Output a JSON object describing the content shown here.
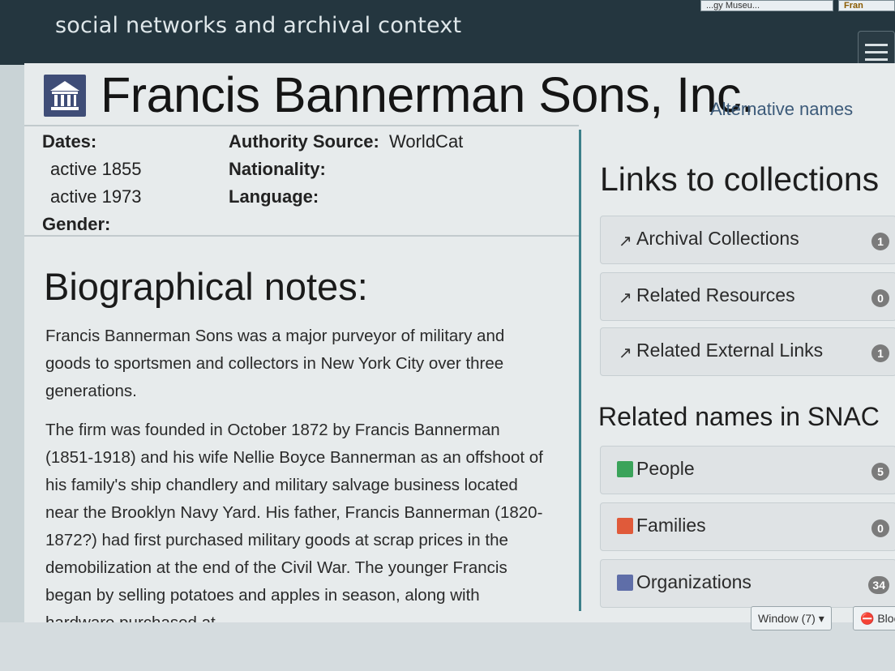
{
  "top": {
    "site_title": "social networks and archival context",
    "tab_a": "...gy Museu...",
    "tab_b": "Fran"
  },
  "entity": {
    "name": "Francis Bannerman Sons, Inc.",
    "alt_names_link": "Alternative names"
  },
  "meta": {
    "dates_label": "Dates:",
    "dates": [
      "active 1855",
      "active 1973"
    ],
    "gender_label": "Gender:",
    "authority_label": "Authority Source:",
    "authority_value": "WorldCat",
    "nationality_label": "Nationality:",
    "language_label": "Language:"
  },
  "bio": {
    "title": "Biographical notes:",
    "paragraphs": [
      "Francis Bannerman Sons was a major purveyor of military and goods to sportsmen and collectors in New York City over three generations.",
      "The firm was founded in October 1872 by Francis Bannerman (1851-1918) and his wife Nellie Boyce Bannerman as an offshoot of his family's ship chandlery and military salvage business located near the Brooklyn Navy Yard. His father, Francis Bannerman (1820-1872?) had first purchased military goods at scrap prices in the demobilization at the end of the Civil War. The younger Francis began by selling potatoes and apples in season, along with hardware purchased at"
    ]
  },
  "links": {
    "title": "Links to collections",
    "items": [
      {
        "label": "Archival Collections",
        "count": "1"
      },
      {
        "label": "Related Resources",
        "count": "0"
      },
      {
        "label": "Related External Links",
        "count": "1"
      }
    ]
  },
  "related": {
    "title": "Related names in SNAC",
    "items": [
      {
        "label": "People",
        "count": "5",
        "color": "#3aa35a"
      },
      {
        "label": "Families",
        "count": "0",
        "color": "#e05a3a"
      },
      {
        "label": "Organizations",
        "count": "34",
        "color": "#5f6ea8"
      }
    ]
  },
  "taskbar": {
    "window_label": "Window (7)",
    "block_label": "Bloc"
  }
}
